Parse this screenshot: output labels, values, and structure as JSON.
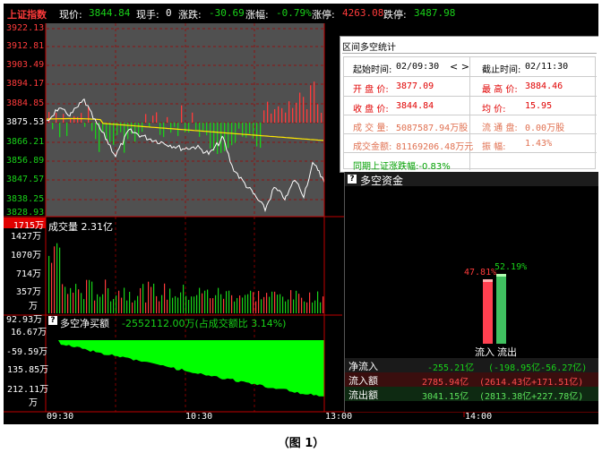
{
  "header": {
    "title": "上证指数",
    "price_label": "现价:",
    "price": "3844.84",
    "hand_label": "现手:",
    "hand": "0",
    "change_label": "涨跌:",
    "change": "-30.69",
    "pct_label": "涨幅:",
    "pct": "-0.79%",
    "limit_up_label": "涨停:",
    "limit_up": "4263.08",
    "limit_down_label": "跌停:",
    "limit_down": "3487.98"
  },
  "price_axis": [
    "3922.13",
    "3912.81",
    "3903.49",
    "3894.17",
    "3884.85",
    "3875.53",
    "3866.21",
    "3856.89",
    "3847.57",
    "3838.25",
    "3828.93"
  ],
  "volume_pane": {
    "title": "成交量  2.31亿",
    "axis_top": "1715万",
    "axis": [
      "1427万",
      "1070万",
      "714万",
      "357万",
      "万"
    ]
  },
  "net_pane": {
    "title": "多空净买额",
    "value": "-2552112.00万(占成交额比 3.14%)",
    "axis": [
      "92.93万",
      "16.67万",
      "-59.59万",
      "135.85万",
      "212.11万",
      "万"
    ]
  },
  "time_axis": [
    "09:30",
    "10:30",
    "13:00",
    "14:00"
  ],
  "stats": {
    "title": "区间多空统计",
    "start_label": "起始时间:",
    "start": "02/09:30",
    "end_label": "截止时间:",
    "end": "02/11:30",
    "nav": "< >",
    "open_label": "开 盘 价:",
    "open": "3877.09",
    "high_label": "最 高 价:",
    "high": "3884.46",
    "close_label": "收 盘 价:",
    "close": "3844.84",
    "avg_label": "均      价:",
    "avg": "15.95",
    "vol_label": "成 交 量:",
    "vol": "5087587.94万股",
    "float_label": "流 通 盘:",
    "float": "0.00万股",
    "amount_label": "成交金额:",
    "amount": "81169206.48万元",
    "amp_label": "振      幅:",
    "amp": "1.43%",
    "index_change": "同期上证涨跌幅:-0.83%"
  },
  "funds": {
    "title": "多空资金",
    "inflow_pct": "47.81%",
    "outflow_pct": "52.19%",
    "inflow_label": "流入",
    "outflow_label": "流出",
    "rows": [
      {
        "label": "净流入",
        "value": "-255.21亿",
        "detail": "(-198.95亿-56.27亿)"
      },
      {
        "label": "流入额",
        "value": "2785.94亿",
        "detail": "(2614.43亿+171.51亿)"
      },
      {
        "label": "流出额",
        "value": "3041.15亿",
        "detail": "(2813.38亿+227.78亿)"
      }
    ]
  },
  "caption": "（图 1）",
  "colors": {
    "up": "#ff3b3b",
    "down": "#19d219",
    "avg_line": "#ffe800",
    "price_line": "#ffffff",
    "plot_bg": "#505050"
  }
}
